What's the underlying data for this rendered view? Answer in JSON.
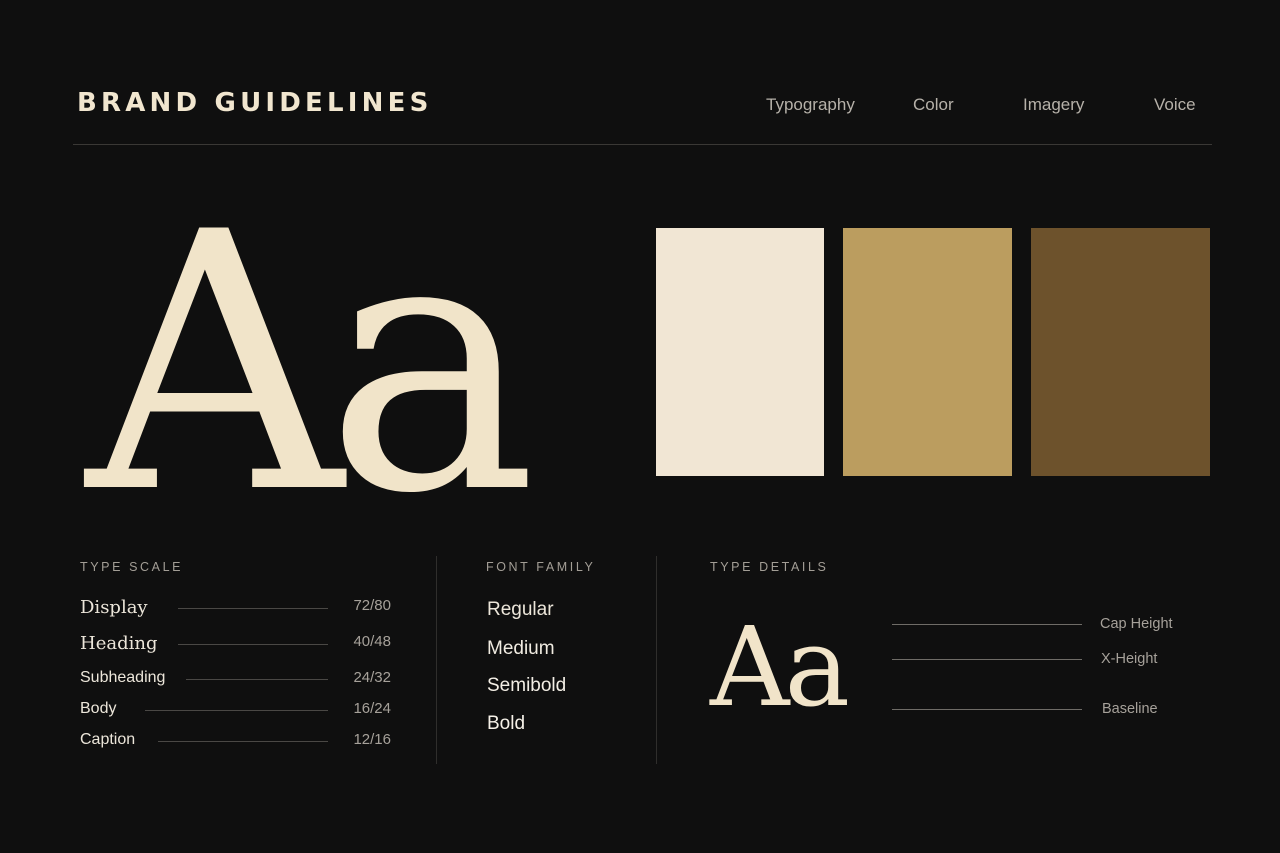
{
  "header": {
    "title": "BRAND GUIDELINES",
    "nav": [
      "Typography",
      "Color",
      "Imagery",
      "Voice"
    ]
  },
  "specimen": {
    "large": "Aa",
    "small": "Aa"
  },
  "colors": {
    "background": "#0f0f0f",
    "specimen": "#f1e4c9",
    "swatches": [
      "#f1e6d4",
      "#bb9d5f",
      "#6d522c"
    ]
  },
  "type_scale": {
    "label": "TYPE SCALE",
    "rows": [
      {
        "name": "Display",
        "value": "72/80"
      },
      {
        "name": "Heading",
        "value": "40/48"
      },
      {
        "name": "Subheading",
        "value": "24/32"
      },
      {
        "name": "Body",
        "value": "16/24"
      },
      {
        "name": "Caption",
        "value": "12/16"
      }
    ]
  },
  "font_family": {
    "label": "FONT FAMILY",
    "weights": [
      "Regular",
      "Medium",
      "Semibold",
      "Bold"
    ]
  },
  "type_details": {
    "label": "TYPE DETAILS",
    "metrics": [
      "Cap Height",
      "X-Height",
      "Baseline"
    ]
  }
}
